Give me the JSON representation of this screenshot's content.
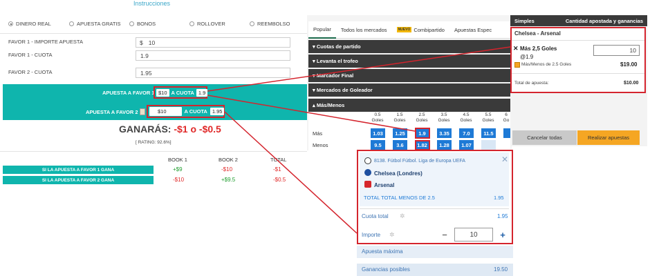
{
  "calculator": {
    "instructions_link": "Instrucciones",
    "modes": [
      "DINERO REAL",
      "APUESTA GRATIS",
      "BONOS",
      "ROLLOVER",
      "REEMBOLSO"
    ],
    "fields": {
      "favor1_amount_label": "FAVOR 1 - IMPORTE APUESTA",
      "favor1_amount_prefix": "$",
      "favor1_amount_value": "10",
      "favor1_odds_label": "FAVOR 1 - CUOTA",
      "favor1_odds_value": "1.9",
      "favor2_odds_label": "FAVOR 2 - CUOTA",
      "favor2_odds_value": "1.95"
    },
    "result": {
      "bet1_prefix": "APUESTA A FAVOR 1",
      "bet1_amount": "$10",
      "bet1_odds_prefix": "A CUOTA",
      "bet1_odds": "1.9",
      "bet2_prefix": "APUESTA A FAVOR 2",
      "bet2_amount": "$10",
      "bet2_odds_prefix": "A CUOTA",
      "bet2_odds": "1.95",
      "win_label": "GANARÁS:",
      "win_min": "-$1",
      "win_connector": "o",
      "win_max": "-$0.5",
      "rating": "[ RATING: 92.6%]"
    },
    "table": {
      "headers": [
        "BOOK 1",
        "BOOK 2",
        "TOTAL"
      ],
      "rows": [
        {
          "label": "SI LA APUESTA A FAVOR 1 GANA",
          "book1": "+$9",
          "book2": "-$10",
          "total": "-$1"
        },
        {
          "label": "SI LA APUESTA A FAVOR 2 GANA",
          "book1": "-$10",
          "book2": "+$9.5",
          "total": "-$0.5"
        }
      ]
    }
  },
  "sportsbook": {
    "tabs": [
      "Popular",
      "Todos los mercados",
      "Combipartido",
      "Apuestas Espec"
    ],
    "new_badge": "NUEVO",
    "sections": [
      "Cuotas de partido",
      "Levanta el trofeo",
      "Marcador Final",
      "Mercados de Goleador",
      "Más/Menos"
    ],
    "goals_columns": [
      "0.5 Goles",
      "1.5 Goles",
      "2.5 Goles",
      "3.5 Goles",
      "4.5 Goles",
      "5.5 Goles",
      "6 Go"
    ],
    "rows": [
      {
        "label": "Más",
        "odds": [
          "1.03",
          "1.25",
          "1.9",
          "3.35",
          "7.0",
          "11.5",
          ""
        ]
      },
      {
        "label": "Menos",
        "odds": [
          "9.5",
          "3.6",
          "1.82",
          "1.28",
          "1.07",
          "",
          ""
        ]
      }
    ]
  },
  "betslip1": {
    "header_left": "Simples",
    "header_right": "Cantidad apostada y ganancias",
    "event": "Chelsea - Arsenal",
    "selection": "Más 2,5 Goles",
    "odds": "@1.9",
    "stake": "10",
    "market": "Más/Menos de 2.5 Goles",
    "payout": "$19.00",
    "total_label": "Total de apuesta:",
    "total_value": "$10.00",
    "cancel": "Cancelar todas",
    "place": "Realizar apuestas"
  },
  "betslip2": {
    "competition": "8138. Fútbol Fútbol. Liga de Europa UEFA",
    "team1": "Chelsea (Londres)",
    "team2": "Arsenal",
    "market": "TOTAL TOTAL MENOS DE 2.5",
    "market_odds": "1.95",
    "total_odds_label": "Cuota total",
    "total_odds_value": "1.95",
    "stake_label": "Importe",
    "stake_value": "10",
    "max_label": "Apuesta máxima",
    "winnings_label": "Ganancias posibles",
    "winnings_value": "19.50"
  },
  "colors": {
    "teal": "#0fb5ad",
    "highlight_red": "#d4242d",
    "odds_blue": "#1e7ad6",
    "orange": "#f5a623",
    "dark": "#3a3a3a"
  }
}
